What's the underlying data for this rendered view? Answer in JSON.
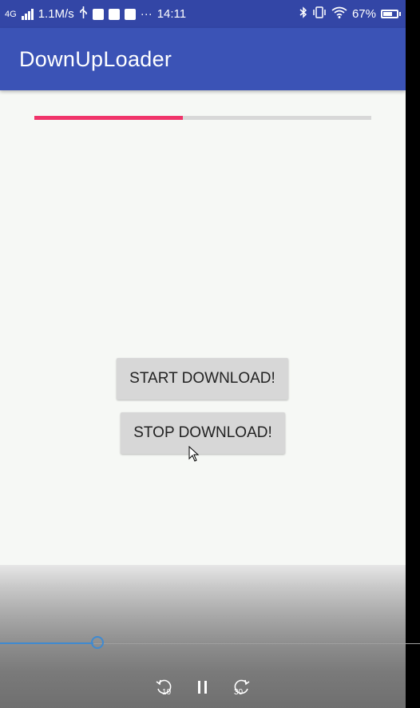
{
  "status_bar": {
    "network": "4G",
    "speed": "1.1M/s",
    "time": "14:11",
    "dots": "···",
    "battery": "67%"
  },
  "app_bar": {
    "title": "DownUpLoader"
  },
  "progress": {
    "value": 0.44,
    "color": "#f0346a"
  },
  "buttons": {
    "start_label": "START DOWNLOAD!",
    "stop_label": "STOP DOWNLOAD!"
  },
  "player": {
    "rewind_label": "10",
    "forward_label": "30",
    "position": 0.23
  },
  "colors": {
    "status_bar": "#3346a6",
    "app_bar": "#3b53b6",
    "accent": "#f0346a",
    "seek": "#3f8ad1"
  }
}
